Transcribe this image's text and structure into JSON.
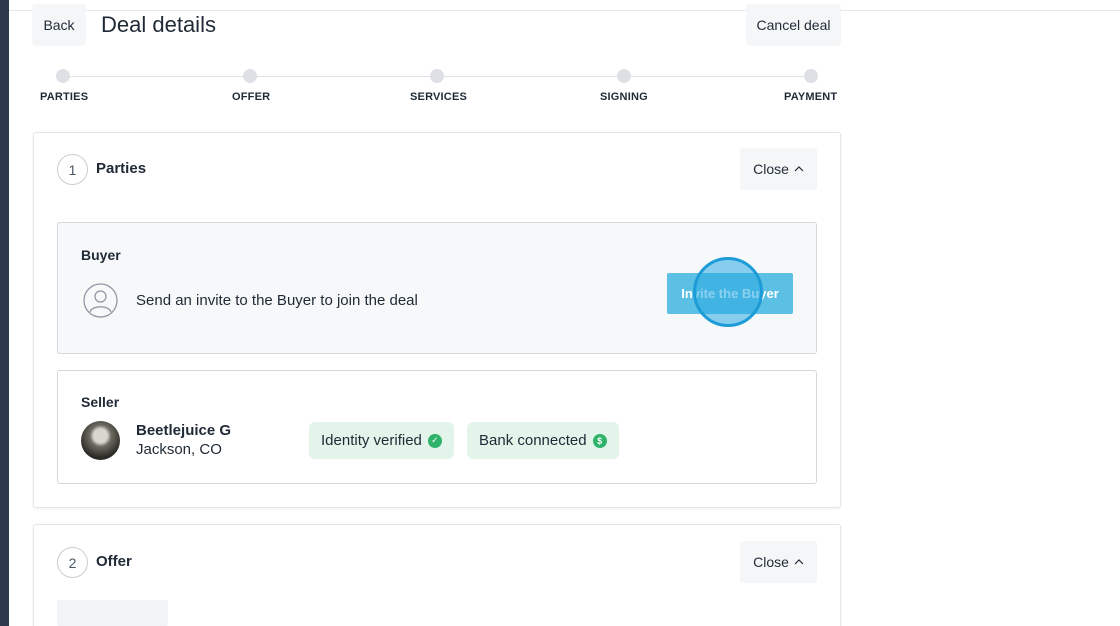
{
  "header": {
    "back_label": "Back",
    "title": "Deal details",
    "cancel_label": "Cancel deal"
  },
  "stepper": {
    "steps": [
      {
        "label": "PARTIES"
      },
      {
        "label": "OFFER"
      },
      {
        "label": "SERVICES"
      },
      {
        "label": "SIGNING"
      },
      {
        "label": "PAYMENT"
      }
    ]
  },
  "parties_section": {
    "number": "1",
    "title": "Parties",
    "close_label": "Close",
    "buyer": {
      "heading": "Buyer",
      "invite_text": "Send an invite to the Buyer to join the deal",
      "invite_button": "Invite the Buyer"
    },
    "seller": {
      "heading": "Seller",
      "name": "Beetlejuice G",
      "location": "Jackson, CO",
      "badges": [
        {
          "label": "Identity verified",
          "icon": "check-circle-icon"
        },
        {
          "label": "Bank connected",
          "icon": "dollar-circle-icon"
        }
      ]
    }
  },
  "offer_section": {
    "number": "2",
    "title": "Offer",
    "close_label": "Close"
  },
  "colors": {
    "sidebar": "#2d3a4d",
    "accent_button": "#5bc0e4",
    "badge_bg": "#e3f4ea",
    "badge_icon": "#2fb36a"
  }
}
